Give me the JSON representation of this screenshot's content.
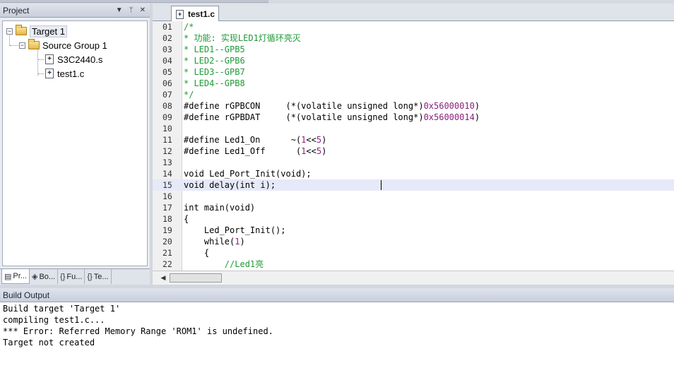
{
  "project_panel": {
    "title": "Project",
    "tree": {
      "target": "Target 1",
      "group": "Source Group 1",
      "files": [
        "S3C2440.s",
        "test1.c"
      ]
    },
    "tabs": [
      "Pr...",
      "Bo...",
      "Fu...",
      "Te..."
    ]
  },
  "editor": {
    "active_tab": "test1.c",
    "lines": [
      {
        "n": "01",
        "text": "/*"
      },
      {
        "n": "02",
        "text": "* 功能: 实现LED1灯循环亮灭"
      },
      {
        "n": "03",
        "text": "* LED1--GPB5"
      },
      {
        "n": "04",
        "text": "* LED2--GPB6"
      },
      {
        "n": "05",
        "text": "* LED3--GPB7"
      },
      {
        "n": "06",
        "text": "* LED4--GPB8"
      },
      {
        "n": "07",
        "text": "*/"
      },
      {
        "n": "08",
        "text": "#define rGPBCON     (*(volatile unsigned long*)0x56000010)"
      },
      {
        "n": "09",
        "text": "#define rGPBDAT     (*(volatile unsigned long*)0x56000014)"
      },
      {
        "n": "10",
        "text": ""
      },
      {
        "n": "11",
        "text": "#define Led1_On      ~(1<<5)"
      },
      {
        "n": "12",
        "text": "#define Led1_Off      (1<<5)"
      },
      {
        "n": "13",
        "text": ""
      },
      {
        "n": "14",
        "text": "void Led_Port_Init(void);"
      },
      {
        "n": "15",
        "text": "void delay(int i);"
      },
      {
        "n": "16",
        "text": ""
      },
      {
        "n": "17",
        "text": "int main(void)"
      },
      {
        "n": "18",
        "text": "{"
      },
      {
        "n": "19",
        "text": "    Led_Port_Init();"
      },
      {
        "n": "20",
        "text": "    while(1)"
      },
      {
        "n": "21",
        "text": "    {"
      },
      {
        "n": "22",
        "text": "        //Led1亮"
      }
    ],
    "current_line": "15"
  },
  "build_output": {
    "title": "Build Output",
    "lines": [
      "Build target 'Target 1'",
      "compiling test1.c...",
      "*** Error: Referred Memory Range 'ROM1' is undefined.",
      "Target not created"
    ]
  },
  "colors": {
    "comment": "#1f9a36",
    "keyword": "#1010b0",
    "number": "#8a1f7a",
    "current_line_bg": "#e6e9f8"
  }
}
